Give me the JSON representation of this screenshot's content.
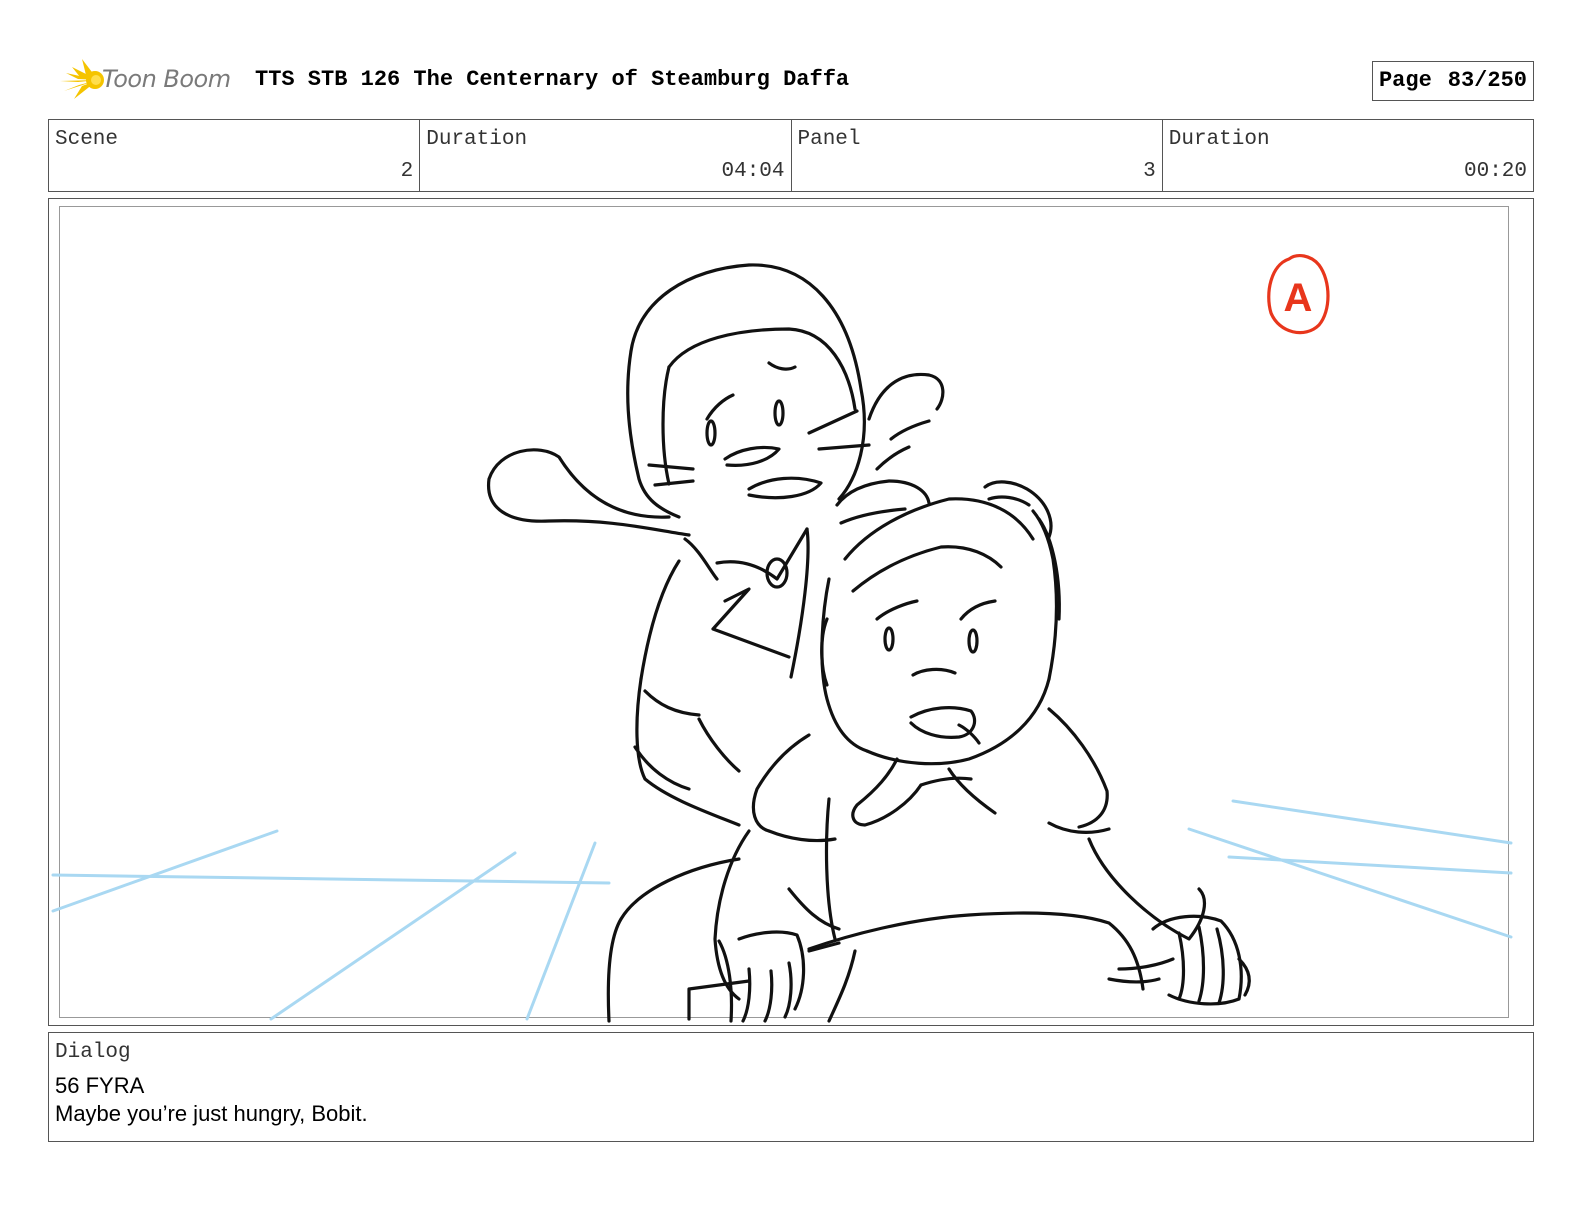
{
  "header": {
    "logo_text": "Toon Boom",
    "title": "TTS STB 126 The Centernary of Steamburg Daffa",
    "page_label": "Page",
    "page_number": "83/250"
  },
  "info": {
    "scene_label": "Scene",
    "scene_value": "2",
    "scene_duration_label": "Duration",
    "scene_duration_value": "04:04",
    "panel_label": "Panel",
    "panel_value": "3",
    "panel_duration_label": "Duration",
    "panel_duration_value": "00:20"
  },
  "panel": {
    "annotation_mark": "A",
    "annotation_color": "#e8361c",
    "guide_line_color": "#a9d8f2",
    "sketch_color": "#111111"
  },
  "dialog": {
    "label": "Dialog",
    "speaker": "56 FYRA",
    "line": "Maybe you’re just hungry, Bobit."
  },
  "brand": {
    "logo_color": "#f5c400"
  }
}
